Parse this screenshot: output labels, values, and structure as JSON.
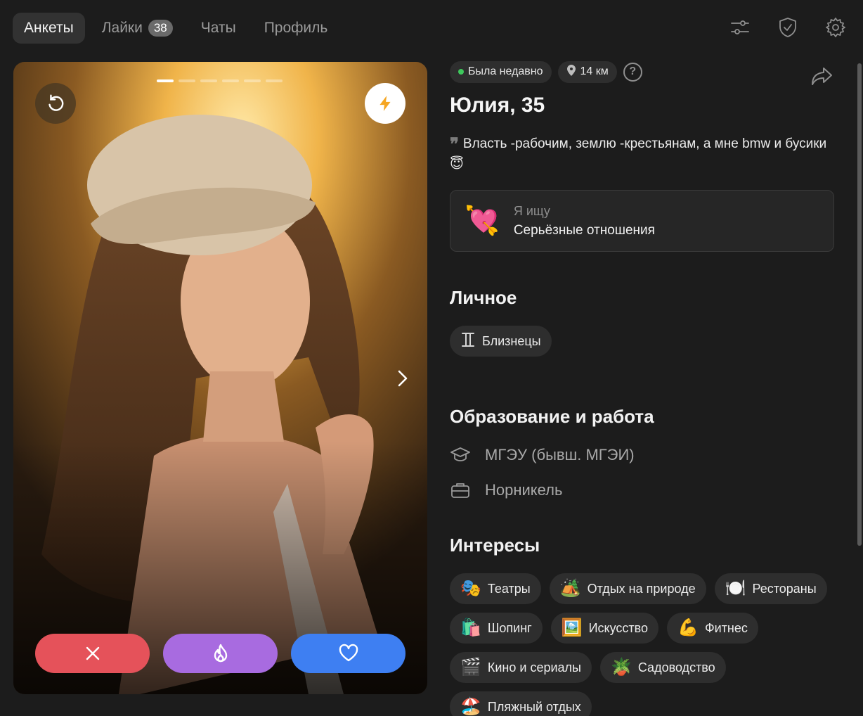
{
  "nav": {
    "tabs": [
      {
        "label": "Анкеты",
        "active": true
      },
      {
        "label": "Лайки",
        "badge": "38"
      },
      {
        "label": "Чаты"
      },
      {
        "label": "Профиль"
      }
    ],
    "icons": [
      "filters-icon",
      "shield-icon",
      "gear-icon"
    ]
  },
  "card": {
    "photo_count": 6,
    "current_photo": 1,
    "actions": [
      "close-icon",
      "flame-icon",
      "heart-icon"
    ]
  },
  "profile": {
    "status": "Была недавно",
    "distance": "14 км",
    "name": "Юлия, 35",
    "bio": "Власть -рабочим, землю -крестьянам, а мне bmw и бусики 😇",
    "goal_label": "Я ищу",
    "goal_value": "Серьёзные отношения",
    "goal_icon": "💘"
  },
  "personal": {
    "title": "Личное",
    "zodiac": "Близнецы"
  },
  "education": {
    "title": "Образование и работа",
    "university": "МГЭУ (бывш. МГЭИ)",
    "work": "Норникель"
  },
  "interests": {
    "title": "Интересы",
    "items": [
      {
        "emoji": "🎭",
        "label": "Театры"
      },
      {
        "emoji": "🏕️",
        "label": "Отдых на природе"
      },
      {
        "emoji": "🍽️",
        "label": "Рестораны"
      },
      {
        "emoji": "🛍️",
        "label": "Шопинг"
      },
      {
        "emoji": "🖼️",
        "label": "Искусство"
      },
      {
        "emoji": "💪",
        "label": "Фитнес"
      },
      {
        "emoji": "🎬",
        "label": "Кино и сериалы"
      },
      {
        "emoji": "🪴",
        "label": "Садоводство"
      },
      {
        "emoji": "🏖️",
        "label": "Пляжный отдых"
      }
    ]
  },
  "colors": {
    "background": "#1c1c1c",
    "dislike": "#e5525a",
    "superlike": "#a86be0",
    "like": "#3e7ff2",
    "online": "#3ec85c"
  }
}
